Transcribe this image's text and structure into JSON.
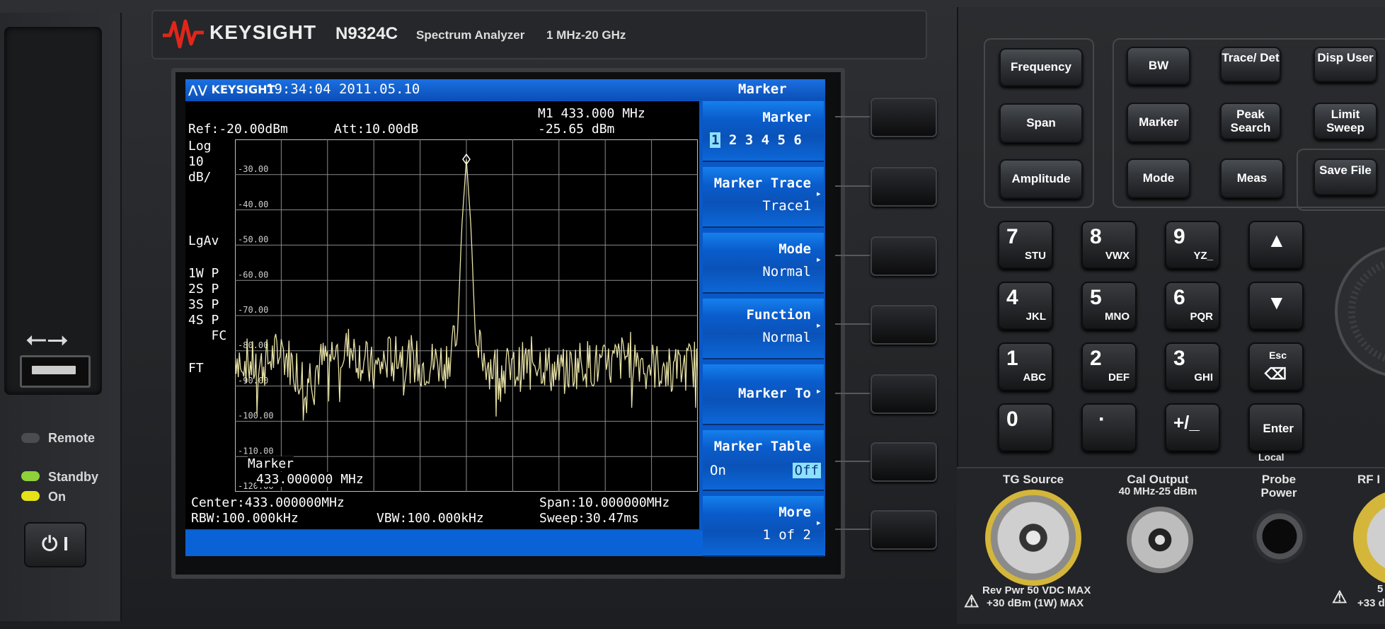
{
  "instrument": {
    "brand": "KEYSIGHT",
    "model": "N9324C",
    "description": "Spectrum Analyzer",
    "frequency_range": "1 MHz-20 GHz"
  },
  "screen": {
    "logo": "KEYSIGHT",
    "datetime": "19:34:04 2011.05.10",
    "menu_title": "Marker",
    "ref_level": "Ref:-20.00dBm",
    "attenuation": "Att:10.00dB",
    "marker_readout_freq": "M1 433.000 MHz",
    "marker_readout_amp": "-25.65 dBm",
    "scale_lines": [
      "Log",
      "10",
      "dB/"
    ],
    "lgav": "LgAv",
    "trace_status": [
      "1W P",
      "2S P",
      "3S P",
      "4S P",
      "   FC"
    ],
    "ft": "FT",
    "y_ticks": [
      "-30.00",
      "-40.00",
      "-50.00",
      "-60.00",
      "-70.00",
      "-80.00",
      "-90.00",
      "-100.00",
      "-110.00",
      "-120.00"
    ],
    "marker_box_title": "Marker",
    "marker_box_value": "433.000000 MHz",
    "center": "Center:433.000000MHz",
    "span": "Span:10.000000MHz",
    "rbw": "RBW:100.000kHz",
    "vbw": "VBW:100.000kHz",
    "sweep": "Sweep:30.47ms"
  },
  "chart_data": {
    "type": "line",
    "xlabel": "",
    "ylabel": "",
    "ylim": [
      -120,
      -20
    ],
    "x_range_mhz": [
      428,
      438
    ],
    "series": [
      {
        "x": [
          428.0,
          428.5,
          429.0,
          429.5,
          430.0,
          430.5,
          431.0,
          431.5,
          432.0,
          432.5,
          432.8,
          432.9,
          433.0,
          433.1,
          433.2,
          433.5,
          434.0,
          434.5,
          435.0,
          435.5,
          436.0,
          436.5,
          437.0,
          437.5,
          438.0
        ],
        "y": [
          -81,
          -85,
          -80,
          -88,
          -82,
          -79,
          -86,
          -80,
          -84,
          -83,
          -78,
          -45,
          -25.65,
          -45,
          -78,
          -84,
          -86,
          -82,
          -87,
          -83,
          -85,
          -81,
          -84,
          -86,
          -83
        ]
      }
    ]
  },
  "softkeys": [
    {
      "title": "Marker",
      "sub": "1 2 3 4 5 6",
      "arrow": ""
    },
    {
      "title": "Marker Trace",
      "sub": "Trace1",
      "arrow": "▸"
    },
    {
      "title": "Mode",
      "sub": "Normal",
      "arrow": "▸"
    },
    {
      "title": "Function",
      "sub": "Normal",
      "arrow": "▸"
    },
    {
      "title": "Marker To",
      "sub": "",
      "arrow": "▸"
    },
    {
      "title": "Marker Table",
      "sub_left": "On",
      "sub_right": "Off",
      "arrow": ""
    },
    {
      "title": "More",
      "sub": "1 of 2",
      "arrow": "▸"
    }
  ],
  "left_panel": {
    "remote": "Remote",
    "standby": "Standby",
    "on": "On",
    "power": "⏻ I",
    "usb_symbol": "⭠⭢"
  },
  "function_keys": {
    "frequency": "Frequency",
    "span": "Span",
    "amplitude": "Amplitude",
    "bw": "BW",
    "trace_det": "Trace/ Det",
    "disp_user": "Disp User",
    "marker": "Marker",
    "peak_search": "Peak Search",
    "limit_sweep": "Limit Sweep",
    "mode": "Mode",
    "meas": "Meas",
    "save_file": "Save File"
  },
  "numpad": [
    {
      "d": "7",
      "l": "STU"
    },
    {
      "d": "8",
      "l": "VWX"
    },
    {
      "d": "9",
      "l": "YZ_"
    },
    {
      "d": "4",
      "l": "JKL"
    },
    {
      "d": "5",
      "l": "MNO"
    },
    {
      "d": "6",
      "l": "PQR"
    },
    {
      "d": "1",
      "l": "ABC"
    },
    {
      "d": "2",
      "l": "DEF"
    },
    {
      "d": "3",
      "l": "GHI"
    },
    {
      "d": "0",
      "l": ""
    },
    {
      "d": "·",
      "l": ""
    },
    {
      "d": "+/_",
      "l": ""
    }
  ],
  "nav_keys": {
    "up": "▲",
    "down": "▼",
    "esc": "Esc",
    "esc_icon": "⌫",
    "enter": "Enter",
    "local": "Local"
  },
  "connectors": {
    "tg_source": "TG Source",
    "cal_output": "Cal Output",
    "cal_output_spec": "40 MHz-25 dBm",
    "probe_power": "Probe Power",
    "rf_in": "RF I",
    "warning_line1": "Rev Pwr 50 VDC MAX",
    "warning_line2": "+30 dBm (1W) MAX",
    "warning_right_1": "5",
    "warning_right_2": "+33 d"
  }
}
